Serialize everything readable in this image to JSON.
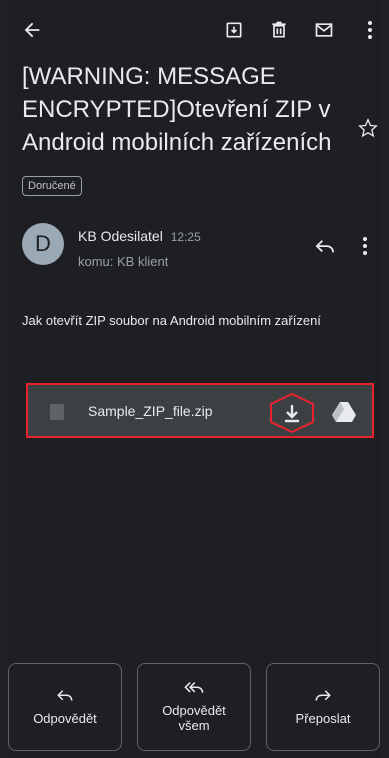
{
  "toolbar": {
    "back_icon": "arrow-left-icon",
    "archive_icon": "archive-icon",
    "delete_icon": "trash-icon",
    "unread_icon": "mail-icon",
    "more_icon": "more-vert-icon"
  },
  "email": {
    "subject": "[WARNING: MESSAGE ENCRYPTED]Otevření ZIP v Android mobilních zařízeních",
    "label": "Doručené",
    "sender_initial": "D",
    "sender_name": "KB Odesilatel",
    "time": "12:25",
    "recipient": "komu: KB klient",
    "body": "Jak otevřít ZIP soubor na Android mobilním zařízení"
  },
  "attachment": {
    "file_name": "Sample_ZIP_file.zip",
    "highlight_color": "#e8232b"
  },
  "actions": [
    {
      "label": "Odpovědět",
      "icon": "reply-icon"
    },
    {
      "label": "Odpovědět všem",
      "icon": "reply-all-icon"
    },
    {
      "label": "Přeposlat",
      "icon": "forward-icon"
    }
  ]
}
